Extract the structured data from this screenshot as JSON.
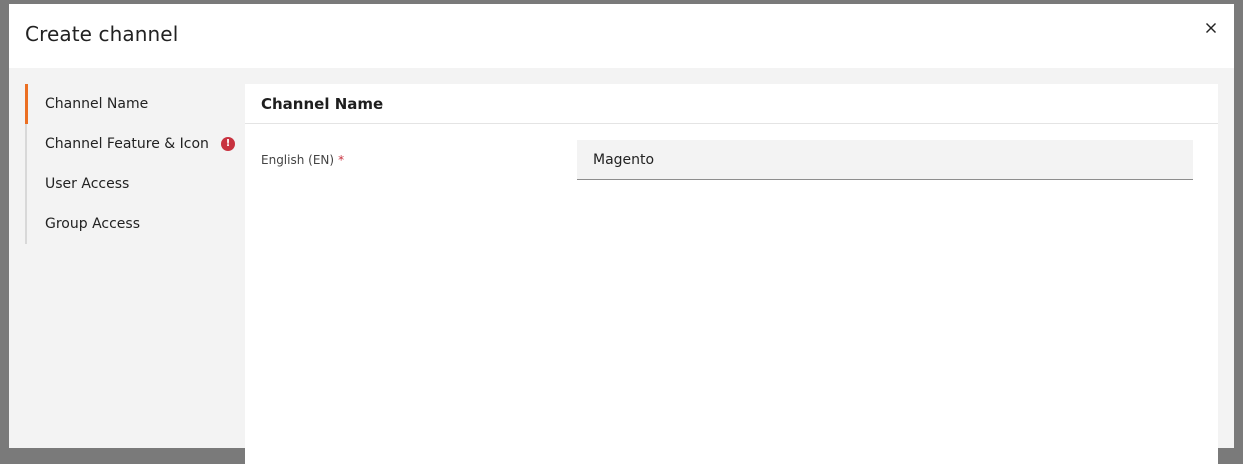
{
  "modal": {
    "title": "Create channel",
    "close_icon": "close-icon"
  },
  "sidebar": {
    "items": [
      {
        "label": "Channel Name",
        "active": true
      },
      {
        "label": "Channel Feature & Icon",
        "has_error": true,
        "error_icon": "exclamation-circle-icon"
      },
      {
        "label": "User Access"
      },
      {
        "label": "Group Access"
      }
    ]
  },
  "content": {
    "section_title": "Channel Name",
    "fields": [
      {
        "label": "English (EN)",
        "required_mark": "*",
        "value": "Magento"
      }
    ]
  },
  "colors": {
    "accent": "#eb6f22",
    "error": "#c8323f",
    "body_bg": "#f3f3f3",
    "overlay": "#7a7a7a"
  }
}
